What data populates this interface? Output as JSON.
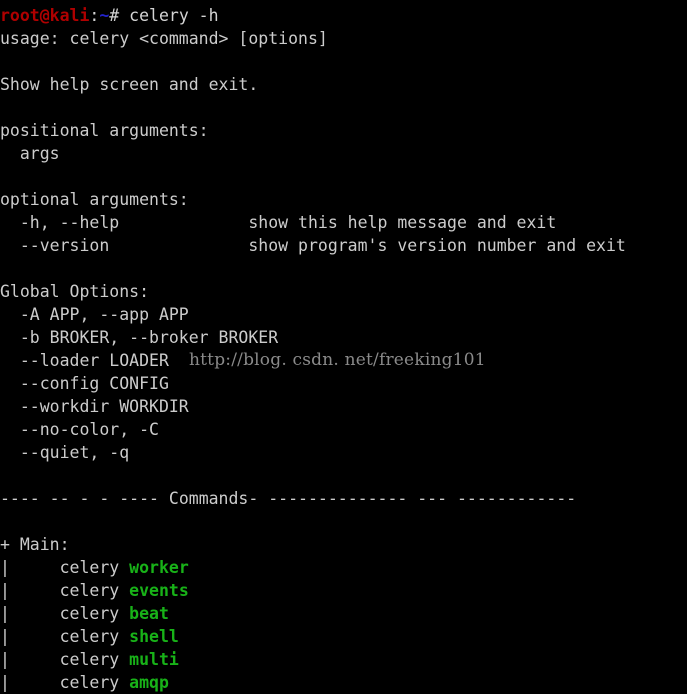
{
  "terminal": {
    "background_color": "#000000",
    "foreground_color": "#cccccc",
    "prompt": {
      "user_host": "root@kali",
      "user_host_color": "#b00000",
      "colon": ":",
      "path": "~",
      "path_color": "#2222cc",
      "sigil_and_command": "# celery -h",
      "command": "celery -h"
    },
    "lines": [
      "usage: celery <command> [options]",
      "",
      "Show help screen and exit.",
      "",
      "positional arguments:",
      "  args",
      "",
      "optional arguments:",
      "  -h, --help             show this help message and exit",
      "  --version              show program's version number and exit",
      "",
      "Global Options:",
      "  -A APP, --app APP",
      "  -b BROKER, --broker BROKER",
      "  --loader LOADER",
      "  --config CONFIG",
      "  --workdir WORKDIR",
      "  --no-color, -C",
      "  --quiet, -q",
      ""
    ],
    "separator": {
      "left_dashes": "---- -- - - ----",
      "label": "Commands",
      "right_dashes": "- -------------- --- ------------"
    },
    "section": {
      "marker": "+",
      "title": "Main:"
    },
    "commands": [
      {
        "pipe": "|",
        "prefix": "celery",
        "name": "worker",
        "color": "#18b218"
      },
      {
        "pipe": "|",
        "prefix": "celery",
        "name": "events",
        "color": "#18b218"
      },
      {
        "pipe": "|",
        "prefix": "celery",
        "name": "beat",
        "color": "#18b218"
      },
      {
        "pipe": "|",
        "prefix": "celery",
        "name": "shell",
        "color": "#18b218"
      },
      {
        "pipe": "|",
        "prefix": "celery",
        "name": "multi",
        "color": "#18b218"
      },
      {
        "pipe": "|",
        "prefix": "celery",
        "name": "amqp",
        "color": "#18b218"
      }
    ]
  },
  "watermark": {
    "text": "http://blog. csdn. net/freeking101",
    "color": "#8a8a8a"
  }
}
